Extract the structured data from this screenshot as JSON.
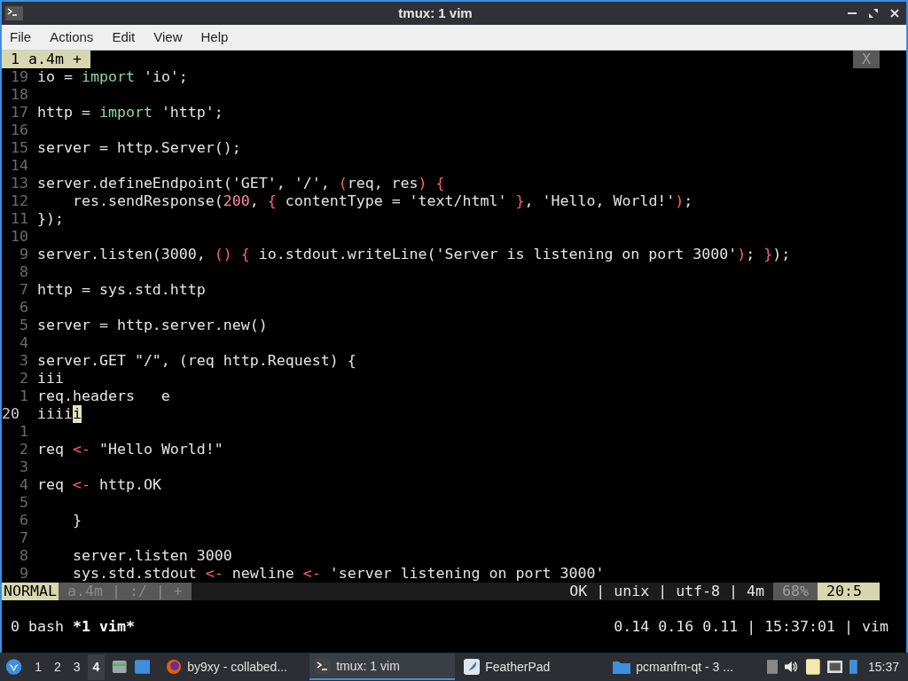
{
  "window": {
    "title": "tmux: 1 vim"
  },
  "menu": [
    "File",
    "Actions",
    "Edit",
    "View",
    "Help"
  ],
  "vim_tabs": [
    {
      "label": "1 a.4m +",
      "selected": true
    }
  ],
  "vim_close_tab": "X",
  "lines": [
    {
      "number": "19",
      "current": false,
      "segments": [
        {
          "text": "io = ",
          "kind": "plain"
        },
        {
          "text": "import",
          "kind": "keyword"
        },
        {
          "text": " 'io';",
          "kind": "plain"
        }
      ]
    },
    {
      "number": "18",
      "current": false
    },
    {
      "number": "17",
      "current": false,
      "segments": [
        {
          "text": "http = ",
          "kind": "plain"
        },
        {
          "text": "import",
          "kind": "keyword"
        },
        {
          "text": " 'http';",
          "kind": "plain"
        }
      ]
    },
    {
      "number": "16",
      "current": false
    },
    {
      "number": "15",
      "current": false,
      "segments": [
        {
          "text": "server = http.Server();",
          "kind": "plain"
        }
      ]
    },
    {
      "number": "14",
      "current": false
    },
    {
      "number": "13",
      "current": false,
      "segments": [
        {
          "text": "server.defineEndpoint('GET', '/', ",
          "kind": "plain"
        },
        {
          "text": "(",
          "kind": "punct"
        },
        {
          "text": "req, res",
          "kind": "plain"
        },
        {
          "text": ")",
          "kind": "punct"
        },
        {
          "text": " {",
          "kind": "punct"
        }
      ]
    },
    {
      "number": "12",
      "current": false,
      "segments": [
        {
          "text": "    res.sendResponse(",
          "kind": "plain"
        },
        {
          "text": "200",
          "kind": "number"
        },
        {
          "text": ", ",
          "kind": "plain"
        },
        {
          "text": "{",
          "kind": "punct"
        },
        {
          "text": " contentType = 'text/html' ",
          "kind": "plain"
        },
        {
          "text": "}",
          "kind": "punct"
        },
        {
          "text": ", 'Hello, World!'",
          "kind": "plain"
        },
        {
          "text": ")",
          "kind": "punct"
        },
        {
          "text": ";",
          "kind": "plain"
        }
      ]
    },
    {
      "number": "11",
      "current": false,
      "segments": [
        {
          "text": "});",
          "kind": "plain"
        }
      ]
    },
    {
      "number": "10",
      "current": false
    },
    {
      "number": "9",
      "current": false,
      "segments": [
        {
          "text": "server.listen(3000, ",
          "kind": "plain"
        },
        {
          "text": "()",
          "kind": "punct"
        },
        {
          "text": " {",
          "kind": "punct"
        },
        {
          "text": " io.stdout.writeLine(",
          "kind": "plain"
        },
        {
          "text": "'Server is listening on port 3000'",
          "kind": "plain"
        },
        {
          "text": ")",
          "kind": "punct"
        },
        {
          "text": "; ",
          "kind": "plain"
        },
        {
          "text": "}",
          "kind": "punct"
        },
        {
          "text": ");",
          "kind": "plain"
        }
      ]
    },
    {
      "number": "8",
      "current": false
    },
    {
      "number": "7",
      "current": false,
      "segments": [
        {
          "text": "http = sys.std.http",
          "kind": "plain"
        }
      ]
    },
    {
      "number": "6",
      "current": false
    },
    {
      "number": "5",
      "current": false,
      "segments": [
        {
          "text": "server = http.server.new()",
          "kind": "plain"
        }
      ]
    },
    {
      "number": "4",
      "current": false
    },
    {
      "number": "3",
      "current": false,
      "segments": [
        {
          "text": "server.GET \"/\", (req http.Request) {",
          "kind": "plain"
        }
      ]
    },
    {
      "number": "2",
      "current": false,
      "segments": [
        {
          "text": "iii",
          "kind": "plain"
        }
      ]
    },
    {
      "number": "1",
      "current": false,
      "segments": [
        {
          "text": "req.headers   e",
          "kind": "plain"
        }
      ]
    },
    {
      "number": "20",
      "current": true,
      "segments": [
        {
          "text": "iiii",
          "kind": "plain"
        },
        {
          "text": "i",
          "kind": "cursor"
        }
      ]
    },
    {
      "number": "1",
      "current": false
    },
    {
      "number": "2",
      "current": false,
      "segments": [
        {
          "text": "req ",
          "kind": "plain"
        },
        {
          "text": "<-",
          "kind": "punct"
        },
        {
          "text": " \"Hello World!\"",
          "kind": "plain"
        }
      ]
    },
    {
      "number": "3",
      "current": false
    },
    {
      "number": "4",
      "current": false,
      "segments": [
        {
          "text": "req ",
          "kind": "plain"
        },
        {
          "text": "<-",
          "kind": "punct"
        },
        {
          "text": " http.OK",
          "kind": "plain"
        }
      ]
    },
    {
      "number": "5",
      "current": false
    },
    {
      "number": "6",
      "current": false,
      "segments": [
        {
          "text": "    }",
          "kind": "plain"
        }
      ]
    },
    {
      "number": "7",
      "current": false
    },
    {
      "number": "8",
      "current": false,
      "segments": [
        {
          "text": "    server.listen 3000",
          "kind": "plain"
        }
      ]
    },
    {
      "number": "9",
      "current": false,
      "segments": [
        {
          "text": "    sys.std.stdout ",
          "kind": "plain"
        },
        {
          "text": "<-",
          "kind": "punct"
        },
        {
          "text": " newline ",
          "kind": "plain"
        },
        {
          "text": "<-",
          "kind": "punct"
        },
        {
          "text": " 'server listening on port 3000'",
          "kind": "plain"
        }
      ]
    }
  ],
  "statusline": {
    "mode": "NORMAL",
    "file_info": "a.4m | :/ | +",
    "right_info": "OK | unix | utf-8 | 4m",
    "percent": "68%",
    "position": "20:5"
  },
  "tmux_status": {
    "windows": [
      {
        "label": "0 bash",
        "selected": false
      },
      {
        "label": "*1 vim*",
        "selected": true
      }
    ],
    "right": "0.14 0.16 0.11 | 15:37:01 | vim"
  },
  "taskbar": {
    "workspaces": [
      {
        "label": "1",
        "selected": false
      },
      {
        "label": "2",
        "selected": false
      },
      {
        "label": "3",
        "selected": false
      },
      {
        "label": "4",
        "selected": true
      }
    ],
    "tasks": [
      {
        "label": "by9xy - collabed...",
        "kind": "browser",
        "selected": false
      },
      {
        "label": "tmux: 1 vim",
        "kind": "terminal",
        "selected": true
      },
      {
        "label": "FeatherPad",
        "kind": "editor",
        "selected": false
      },
      {
        "label": "pcmanfm-qt - 3 ...",
        "kind": "folder",
        "selected": false
      }
    ],
    "clock": "15:37"
  }
}
